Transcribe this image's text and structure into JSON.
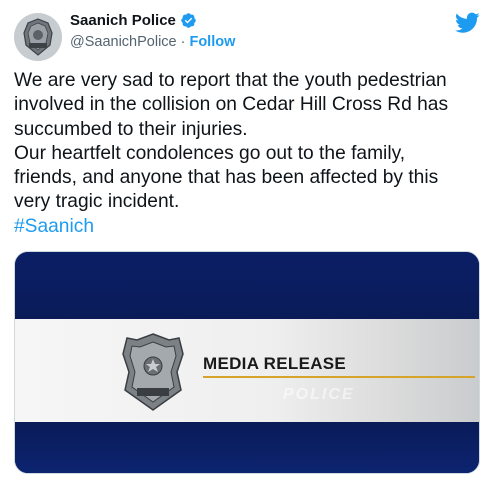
{
  "account": {
    "display_name": "Saanich Police",
    "handle": "@SaanichPolice",
    "separator": "·",
    "follow_label": "Follow",
    "avatar_icon": "police-badge-icon",
    "verified_icon": "verified-badge-icon",
    "badge_lettering": [
      "SAANICH",
      "POLICE"
    ]
  },
  "brand": {
    "icon": "twitter-bird-icon",
    "color": "#1d9bf0"
  },
  "tweet": {
    "text": "We are very sad to report that the youth pedestrian\ninvolved in the collision on Cedar Hill Cross Rd has\nsuccumbed to their injuries.\nOur heartfelt condolences go out to the family,\nfriends, and anyone that has been affected by this\nvery tragic incident.",
    "hashtag": "#Saanich"
  },
  "media": {
    "title": "MEDIA RELEASE",
    "watermark": "POLICE",
    "badge_icon": "police-badge-icon",
    "badge_lettering": [
      "SAANICH",
      "POLICE"
    ],
    "colors": {
      "navy": "#0a1e5c",
      "gold": "#d4a52a"
    }
  }
}
